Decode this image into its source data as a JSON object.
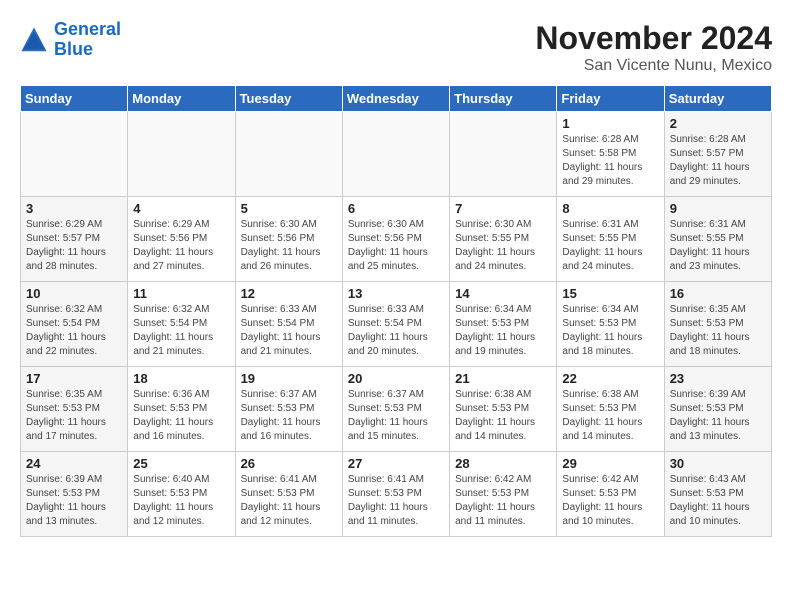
{
  "header": {
    "logo_general": "General",
    "logo_blue": "Blue",
    "month_title": "November 2024",
    "location": "San Vicente Nunu, Mexico"
  },
  "calendar": {
    "days_of_week": [
      "Sunday",
      "Monday",
      "Tuesday",
      "Wednesday",
      "Thursday",
      "Friday",
      "Saturday"
    ],
    "weeks": [
      [
        {
          "day": "",
          "info": ""
        },
        {
          "day": "",
          "info": ""
        },
        {
          "day": "",
          "info": ""
        },
        {
          "day": "",
          "info": ""
        },
        {
          "day": "",
          "info": ""
        },
        {
          "day": "1",
          "info": "Sunrise: 6:28 AM\nSunset: 5:58 PM\nDaylight: 11 hours\nand 29 minutes."
        },
        {
          "day": "2",
          "info": "Sunrise: 6:28 AM\nSunset: 5:57 PM\nDaylight: 11 hours\nand 29 minutes."
        }
      ],
      [
        {
          "day": "3",
          "info": "Sunrise: 6:29 AM\nSunset: 5:57 PM\nDaylight: 11 hours\nand 28 minutes."
        },
        {
          "day": "4",
          "info": "Sunrise: 6:29 AM\nSunset: 5:56 PM\nDaylight: 11 hours\nand 27 minutes."
        },
        {
          "day": "5",
          "info": "Sunrise: 6:30 AM\nSunset: 5:56 PM\nDaylight: 11 hours\nand 26 minutes."
        },
        {
          "day": "6",
          "info": "Sunrise: 6:30 AM\nSunset: 5:56 PM\nDaylight: 11 hours\nand 25 minutes."
        },
        {
          "day": "7",
          "info": "Sunrise: 6:30 AM\nSunset: 5:55 PM\nDaylight: 11 hours\nand 24 minutes."
        },
        {
          "day": "8",
          "info": "Sunrise: 6:31 AM\nSunset: 5:55 PM\nDaylight: 11 hours\nand 24 minutes."
        },
        {
          "day": "9",
          "info": "Sunrise: 6:31 AM\nSunset: 5:55 PM\nDaylight: 11 hours\nand 23 minutes."
        }
      ],
      [
        {
          "day": "10",
          "info": "Sunrise: 6:32 AM\nSunset: 5:54 PM\nDaylight: 11 hours\nand 22 minutes."
        },
        {
          "day": "11",
          "info": "Sunrise: 6:32 AM\nSunset: 5:54 PM\nDaylight: 11 hours\nand 21 minutes."
        },
        {
          "day": "12",
          "info": "Sunrise: 6:33 AM\nSunset: 5:54 PM\nDaylight: 11 hours\nand 21 minutes."
        },
        {
          "day": "13",
          "info": "Sunrise: 6:33 AM\nSunset: 5:54 PM\nDaylight: 11 hours\nand 20 minutes."
        },
        {
          "day": "14",
          "info": "Sunrise: 6:34 AM\nSunset: 5:53 PM\nDaylight: 11 hours\nand 19 minutes."
        },
        {
          "day": "15",
          "info": "Sunrise: 6:34 AM\nSunset: 5:53 PM\nDaylight: 11 hours\nand 18 minutes."
        },
        {
          "day": "16",
          "info": "Sunrise: 6:35 AM\nSunset: 5:53 PM\nDaylight: 11 hours\nand 18 minutes."
        }
      ],
      [
        {
          "day": "17",
          "info": "Sunrise: 6:35 AM\nSunset: 5:53 PM\nDaylight: 11 hours\nand 17 minutes."
        },
        {
          "day": "18",
          "info": "Sunrise: 6:36 AM\nSunset: 5:53 PM\nDaylight: 11 hours\nand 16 minutes."
        },
        {
          "day": "19",
          "info": "Sunrise: 6:37 AM\nSunset: 5:53 PM\nDaylight: 11 hours\nand 16 minutes."
        },
        {
          "day": "20",
          "info": "Sunrise: 6:37 AM\nSunset: 5:53 PM\nDaylight: 11 hours\nand 15 minutes."
        },
        {
          "day": "21",
          "info": "Sunrise: 6:38 AM\nSunset: 5:53 PM\nDaylight: 11 hours\nand 14 minutes."
        },
        {
          "day": "22",
          "info": "Sunrise: 6:38 AM\nSunset: 5:53 PM\nDaylight: 11 hours\nand 14 minutes."
        },
        {
          "day": "23",
          "info": "Sunrise: 6:39 AM\nSunset: 5:53 PM\nDaylight: 11 hours\nand 13 minutes."
        }
      ],
      [
        {
          "day": "24",
          "info": "Sunrise: 6:39 AM\nSunset: 5:53 PM\nDaylight: 11 hours\nand 13 minutes."
        },
        {
          "day": "25",
          "info": "Sunrise: 6:40 AM\nSunset: 5:53 PM\nDaylight: 11 hours\nand 12 minutes."
        },
        {
          "day": "26",
          "info": "Sunrise: 6:41 AM\nSunset: 5:53 PM\nDaylight: 11 hours\nand 12 minutes."
        },
        {
          "day": "27",
          "info": "Sunrise: 6:41 AM\nSunset: 5:53 PM\nDaylight: 11 hours\nand 11 minutes."
        },
        {
          "day": "28",
          "info": "Sunrise: 6:42 AM\nSunset: 5:53 PM\nDaylight: 11 hours\nand 11 minutes."
        },
        {
          "day": "29",
          "info": "Sunrise: 6:42 AM\nSunset: 5:53 PM\nDaylight: 11 hours\nand 10 minutes."
        },
        {
          "day": "30",
          "info": "Sunrise: 6:43 AM\nSunset: 5:53 PM\nDaylight: 11 hours\nand 10 minutes."
        }
      ]
    ]
  }
}
